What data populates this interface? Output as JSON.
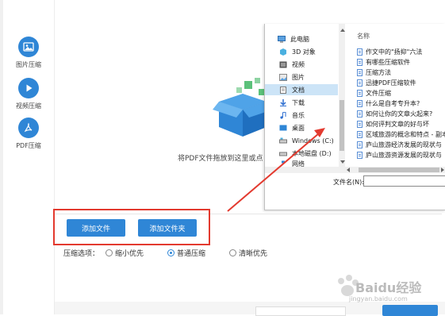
{
  "sidebar": {
    "items": [
      {
        "label": "图片压缩",
        "icon": "image-icon"
      },
      {
        "label": "视频压缩",
        "icon": "play-icon"
      },
      {
        "label": "PDF压缩",
        "icon": "pdf-icon"
      }
    ]
  },
  "main": {
    "drop_hint": "将PDF文件拖放到这里或点",
    "add_file_button": "添加文件",
    "add_folder_button": "添加文件夹",
    "compress_options_label": "压缩选项：",
    "options": [
      {
        "label": "缩小优先",
        "checked": false
      },
      {
        "label": "普通压缩",
        "checked": true
      },
      {
        "label": "清晰优先",
        "checked": false
      }
    ]
  },
  "dialog": {
    "tree": [
      {
        "label": "此电脑",
        "icon": "computer-icon"
      },
      {
        "label": "3D 对象",
        "icon": "cube-icon"
      },
      {
        "label": "视频",
        "icon": "video-icon"
      },
      {
        "label": "图片",
        "icon": "picture-icon"
      },
      {
        "label": "文档",
        "icon": "document-icon",
        "selected": true
      },
      {
        "label": "下载",
        "icon": "download-icon"
      },
      {
        "label": "音乐",
        "icon": "music-icon"
      },
      {
        "label": "桌面",
        "icon": "desktop-icon"
      },
      {
        "label": "Windows (C:)",
        "icon": "drive-icon"
      },
      {
        "label": "本地磁盘 (D:)",
        "icon": "drive-icon"
      },
      {
        "label": "网络",
        "icon": "network-icon"
      }
    ],
    "column_header": "名称",
    "files": [
      "作文中的\"扬抑\"六法",
      "有哪些压缩软件",
      "压缩方法",
      "迅捷PDF压缩软件",
      "文件压缩",
      "什么是自考专升本?",
      "如何让你的文章火起来?",
      "如何评判文章的好与坏",
      "区域旅游的概念和特点 - 副本",
      "庐山旅游经济发展的现状与",
      "庐山旅游资源发展的现状与"
    ],
    "filename_label": "文件名(N):",
    "filename_value": ""
  },
  "watermark": {
    "brand": "Baidu经验",
    "url": "jingyan.baidu.com"
  },
  "colors": {
    "accent": "#2f86d6",
    "highlight_red": "#e33a2f",
    "selection": "#cce4f7"
  }
}
